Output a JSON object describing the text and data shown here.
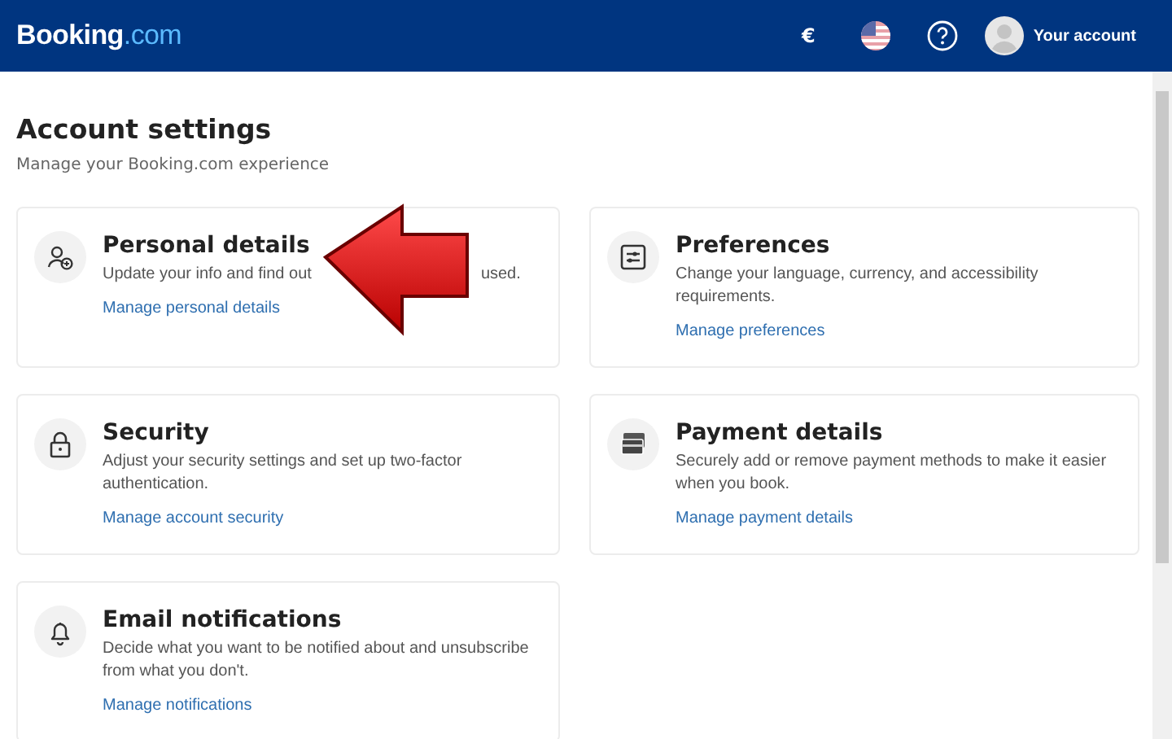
{
  "header": {
    "logo_main": "Booking",
    "logo_suffix": ".com",
    "currency": "€",
    "account_label": "Your account"
  },
  "page": {
    "title": "Account settings",
    "subtitle": "Manage your Booking.com experience"
  },
  "cards": [
    {
      "kind": "person",
      "title": "Personal details",
      "description": [
        "Update your info and find out",
        "used."
      ],
      "link": "Manage personal details",
      "annotated": true
    },
    {
      "kind": "sliders",
      "title": "Preferences",
      "description": [
        "Change your language, currency, and accessibility requirements."
      ],
      "link": "Manage preferences",
      "annotated": false
    },
    {
      "kind": "lock",
      "title": "Security",
      "description": [
        "Adjust your security settings and set up two-factor authentication."
      ],
      "link": "Manage account security",
      "annotated": false
    },
    {
      "kind": "card",
      "title": "Payment details",
      "description": [
        "Securely add or remove payment methods to make it easier when you book."
      ],
      "link": "Manage payment details",
      "annotated": false
    },
    {
      "kind": "bell",
      "title": "Email notifications",
      "description": [
        "Decide what you want to be notified about and unsubscribe from what you don't."
      ],
      "link": "Manage notifications",
      "annotated": false
    }
  ]
}
